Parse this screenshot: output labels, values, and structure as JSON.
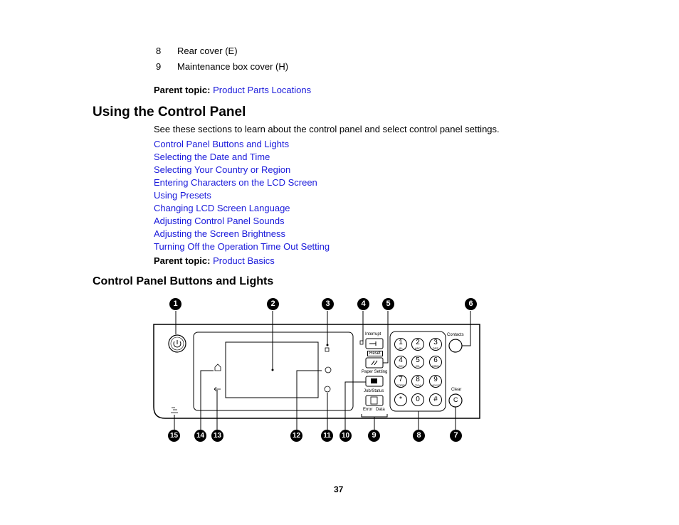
{
  "list_items": [
    {
      "num": "8",
      "text": "Rear cover (E)"
    },
    {
      "num": "9",
      "text": "Maintenance box cover (H)"
    }
  ],
  "parent_topic_1": {
    "label": "Parent topic:",
    "link": "Product Parts Locations"
  },
  "section": {
    "title": "Using the Control Panel",
    "intro": "See these sections to learn about the control panel and select control panel settings.",
    "links": [
      "Control Panel Buttons and Lights",
      "Selecting the Date and Time",
      "Selecting Your Country or Region",
      "Entering Characters on the LCD Screen",
      "Using Presets",
      "Changing LCD Screen Language",
      "Adjusting Control Panel Sounds",
      "Adjusting the Screen Brightness",
      "Turning Off the Operation Time Out Setting"
    ]
  },
  "parent_topic_2": {
    "label": "Parent topic:",
    "link": "Product Basics"
  },
  "subsection": {
    "title": "Control Panel Buttons and Lights"
  },
  "figure": {
    "callouts_top": [
      "1",
      "2",
      "3",
      "4",
      "5",
      "6"
    ],
    "callouts_bottom": [
      "15",
      "14",
      "13",
      "12",
      "11",
      "10",
      "9",
      "8",
      "7"
    ],
    "panel_labels": {
      "interrupt": "Interrupt",
      "reset": "Reset",
      "paper_setting": "Paper Setting",
      "job_status": "Job/Status",
      "error": "Error",
      "data": "Data",
      "contacts": "Contacts",
      "clear": "Clear",
      "clear_glyph": "C"
    },
    "keypad": [
      {
        "num": "1",
        "sub": "@/:"
      },
      {
        "num": "2",
        "sub": "ABC"
      },
      {
        "num": "3",
        "sub": "DEF"
      },
      {
        "num": "4",
        "sub": "GHI"
      },
      {
        "num": "5",
        "sub": "JKL"
      },
      {
        "num": "6",
        "sub": "MNO"
      },
      {
        "num": "7",
        "sub": "PQRS"
      },
      {
        "num": "8",
        "sub": "TUV"
      },
      {
        "num": "9",
        "sub": "WXYZ"
      },
      {
        "num": "*",
        "sub": ""
      },
      {
        "num": "0",
        "sub": ""
      },
      {
        "num": "#",
        "sub": ""
      }
    ]
  },
  "page_number": "37"
}
